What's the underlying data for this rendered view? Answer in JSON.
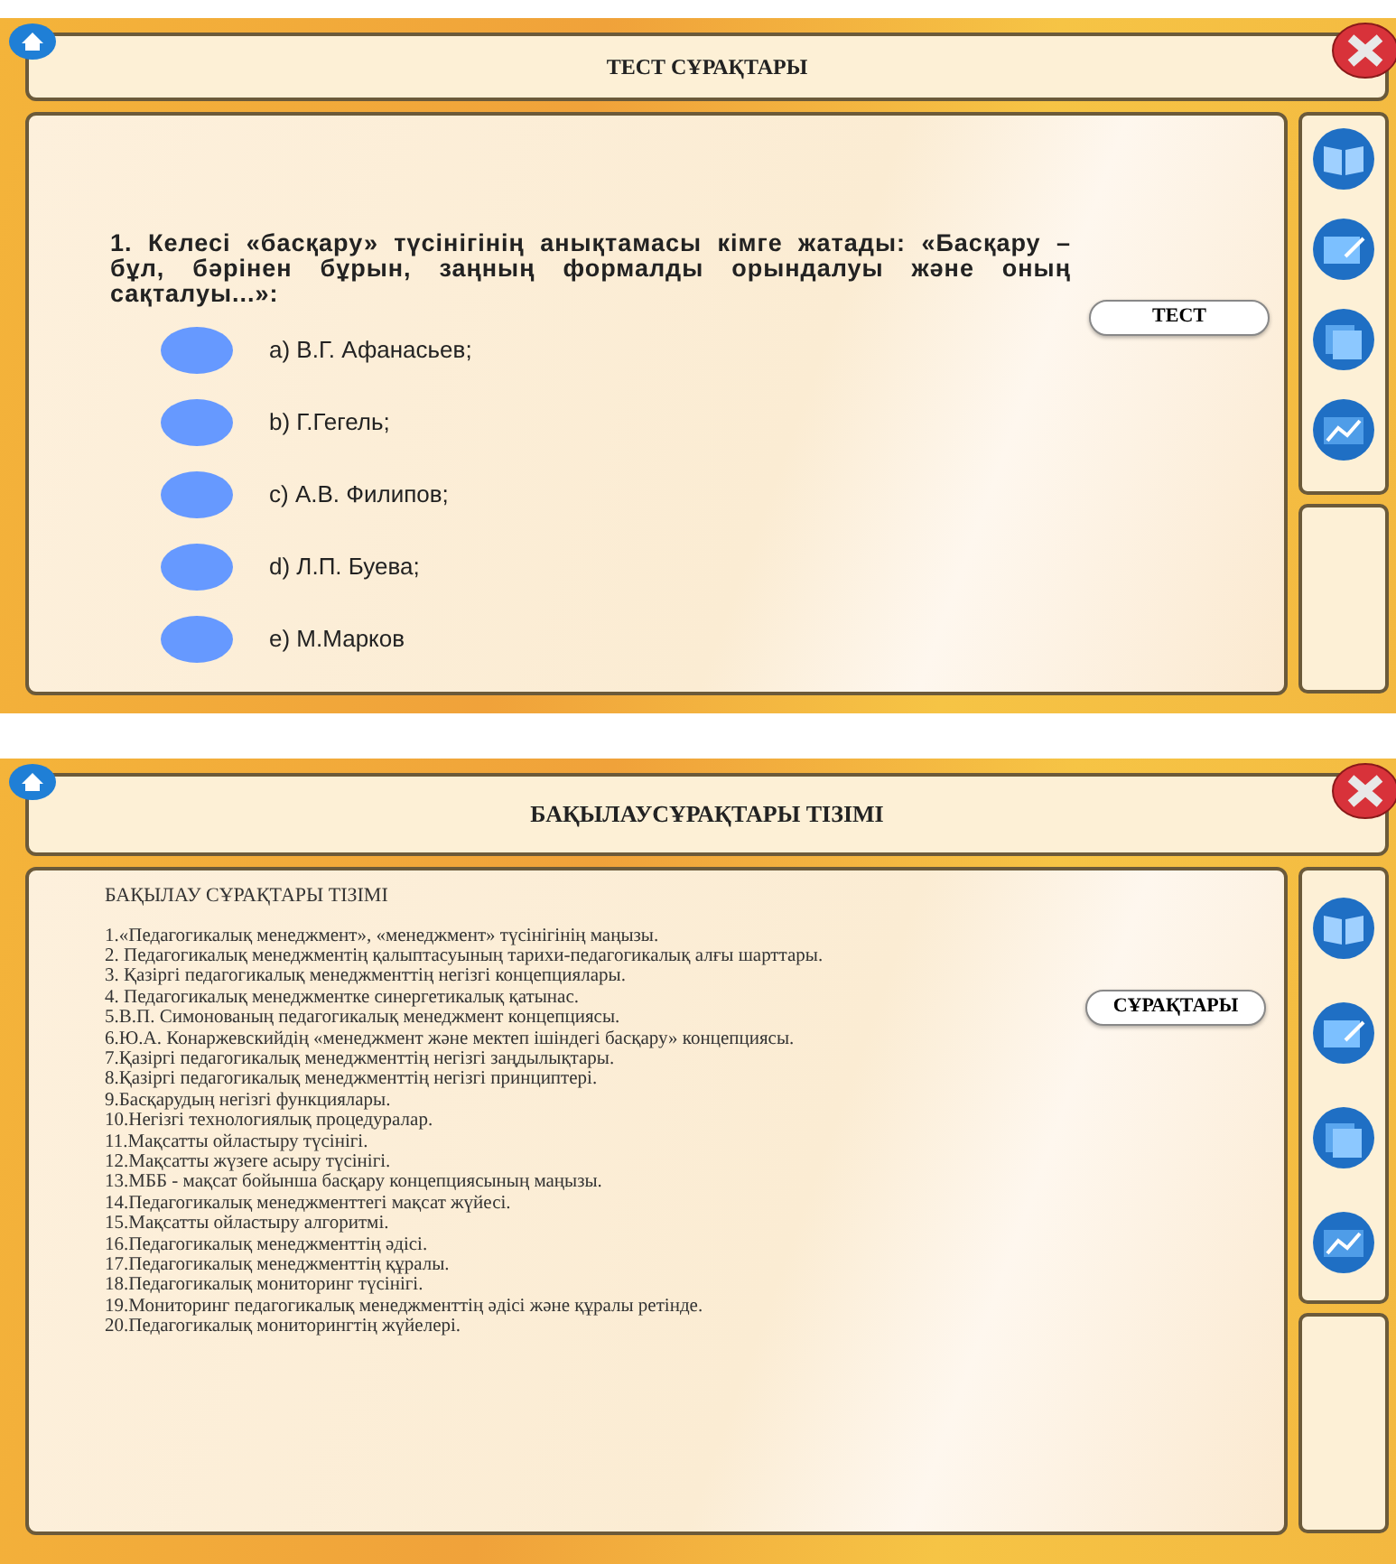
{
  "screens": [
    {
      "kind": "quiz",
      "title": "ТЕСТ СҰРАҚТАРЫ",
      "question": "1. Келесі «басқару» түсінігінің анықтамасы кімге жатады: «Басқару – бұл, бәрінен бұрын, заңның формалды орындалуы және оның сақталуы...»:",
      "options": [
        {
          "label": "a) В.Г. Афанасьев;",
          "selected": false
        },
        {
          "label": "b) Г.Гегель;",
          "selected": false
        },
        {
          "label": "c) А.В. Филипов;",
          "selected": false
        },
        {
          "label": "d) Л.П. Буева;",
          "selected": false
        },
        {
          "label": "e) М.Марков",
          "selected": false
        }
      ],
      "button": "ТЕСТ"
    },
    {
      "kind": "list",
      "title": "БАҚЫЛАУСҰРАҚТАРЫ ТІЗІМІ",
      "heading": "БАҚЫЛАУ СҰРАҚТАРЫ ТІЗІМІ",
      "items": [
        "1.«Педагогикалық менеджмент», «менеджмент» түсінігінің маңызы.",
        "2. Педагогикалық менеджментің қалыптасуының тарихи-педагогикалық алғы шарттары.",
        "3. Қазіргі педагогикалық менеджменттің негізгі концепциялары.",
        "4. Педагогикалық менеджментке синергетикалық қатынас.",
        "5.В.П. Симонованың педагогикалық менеджмент концепциясы.",
        "6.Ю.А. Конаржевскийдің «менеджмент және мектеп ішіндегі басқару» концепциясы.",
        "7.Қазіргі педагогикалық менеджменттің негізгі заңдылықтары.",
        "8.Қазіргі педагогикалық менеджменттің негізгі принциптері.",
        "9.Басқарудың негізгі функциялары.",
        "10.Негізгі технологиялық процедуралар.",
        "11.Мақсатты ойластыру түсінігі.",
        "12.Мақсатты жүзеге асыру түсінігі.",
        "13.МББ - мақсат бойынша басқару концепциясының маңызы.",
        "14.Педагогикалық менеджменттегі мақсат жүйесі.",
        "15.Мақсатты ойластыру алгоритмі.",
        "16.Педагогикалық менеджменттің әдісі.",
        "17.Педагогикалық менеджменттің құралы.",
        "18.Педагогикалық мониторинг түсінігі.",
        "19.Мониторинг педагогикалық менеджменттің әдісі және құралы ретінде.",
        "20.Педагогикалық мониторингтің жүйелері."
      ],
      "button": "СҰРАҚТАРЫ"
    }
  ]
}
